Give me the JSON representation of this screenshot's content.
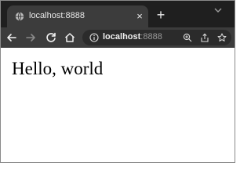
{
  "tab": {
    "title": "localhost:8888",
    "close_glyph": "×",
    "favicon": "globe-icon"
  },
  "new_tab": {
    "glyph": "+"
  },
  "toolbar": {
    "icons": [
      "back-arrow-icon",
      "forward-arrow-icon",
      "reload-icon",
      "home-icon"
    ]
  },
  "address_bar": {
    "host": "localhost",
    "port": ":8888",
    "icons": [
      "info-icon",
      "zoom-icon",
      "share-icon",
      "star-icon"
    ]
  },
  "page": {
    "heading": "Hello, world"
  },
  "colors": {
    "tabstrip_bg": "#1f1f1f",
    "active_tab_bg": "#3c3c3c",
    "toolbar_bg": "#3c3c3c",
    "omnibox_bg": "#2b2b2b",
    "page_bg": "#ffffff"
  }
}
